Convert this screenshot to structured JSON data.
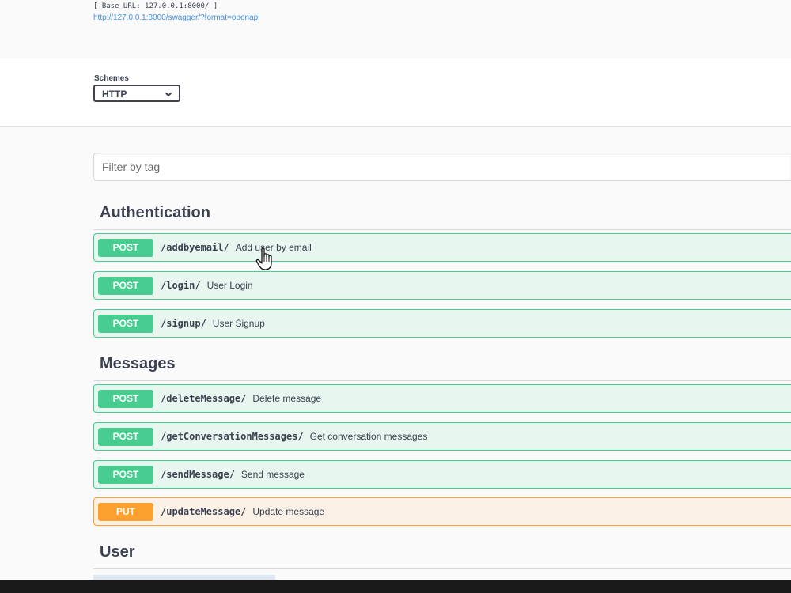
{
  "info": {
    "base_url": "[ Base URL: 127.0.0.1:8000/ ]",
    "spec_link": "http://127.0.0.1:8000/swagger/?format=openapi"
  },
  "schemes": {
    "label": "Schemes",
    "selected": "HTTP"
  },
  "filter": {
    "placeholder": "Filter by tag"
  },
  "colors": {
    "post": "#49cc90",
    "put": "#fca130",
    "link": "#4990e2"
  },
  "tags": [
    {
      "name": "Authentication",
      "operations": [
        {
          "method": "POST",
          "path": "/addbyemail/",
          "summary": "Add user by email"
        },
        {
          "method": "POST",
          "path": "/login/",
          "summary": "User Login"
        },
        {
          "method": "POST",
          "path": "/signup/",
          "summary": "User Signup"
        }
      ]
    },
    {
      "name": "Messages",
      "operations": [
        {
          "method": "POST",
          "path": "/deleteMessage/",
          "summary": "Delete message"
        },
        {
          "method": "POST",
          "path": "/getConversationMessages/",
          "summary": "Get conversation messages"
        },
        {
          "method": "POST",
          "path": "/sendMessage/",
          "summary": "Send message"
        },
        {
          "method": "PUT",
          "path": "/updateMessage/",
          "summary": "Update message"
        }
      ]
    },
    {
      "name": "User",
      "operations": []
    }
  ]
}
